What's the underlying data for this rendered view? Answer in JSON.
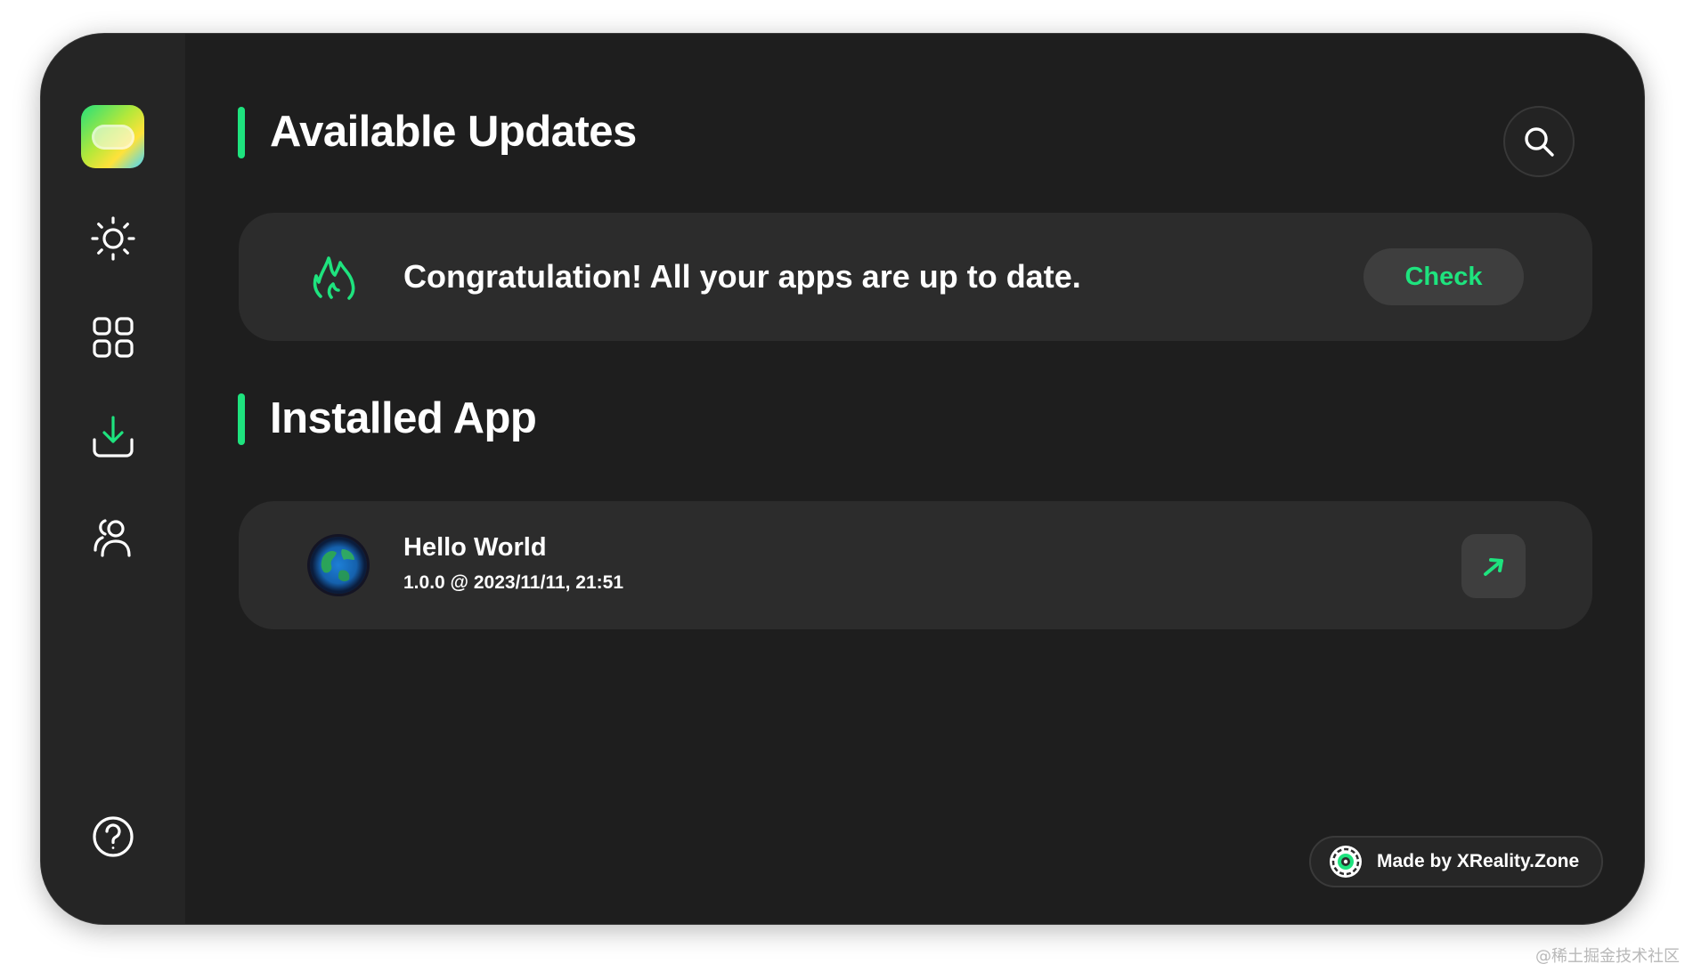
{
  "sidebar": {
    "items": [
      {
        "name": "sun-icon",
        "label": "Discover"
      },
      {
        "name": "grid-icon",
        "label": "Apps"
      },
      {
        "name": "download-icon",
        "label": "Updates"
      },
      {
        "name": "users-icon",
        "label": "Account"
      }
    ],
    "help_icon": "question-circle-icon"
  },
  "updates": {
    "title": "Available Updates",
    "message": "Congratulation! All your apps are up to date.",
    "check_label": "Check",
    "status_icon": "flame-icon"
  },
  "installed": {
    "title": "Installed App",
    "apps": [
      {
        "name": "Hello World",
        "meta": "1.0.0 @ 2023/11/11, 21:51",
        "icon": "globe-icon",
        "action_icon": "arrow-up-right-icon"
      }
    ]
  },
  "credit": {
    "label": "Made by XReality.Zone",
    "icon": "xreality-logo-icon"
  },
  "watermark": "@稀土掘金技术社区",
  "colors": {
    "accent": "#1ee37e",
    "background": "#1e1e1e",
    "sidebar": "#252525",
    "card": "#2c2c2c",
    "button": "#3e3e3e"
  }
}
